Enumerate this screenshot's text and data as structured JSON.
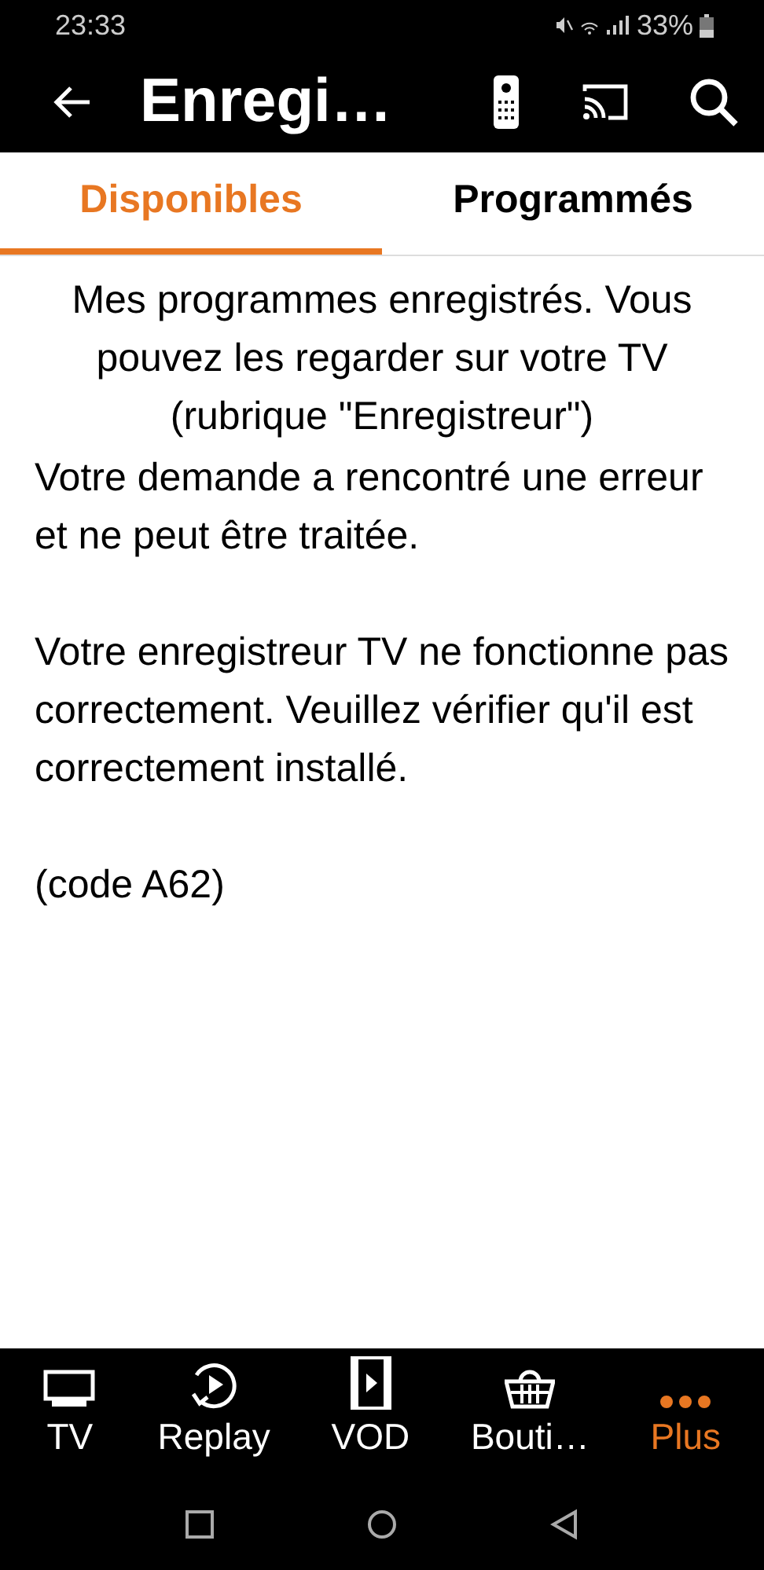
{
  "status_bar": {
    "time": "23:33",
    "battery": "33%"
  },
  "app_bar": {
    "title": "Enregi…"
  },
  "tabs": [
    {
      "label": "Disponibles",
      "selected": true
    },
    {
      "label": "Programmés",
      "selected": false
    }
  ],
  "intro": "Mes programmes enregistrés. Vous pouvez les regarder sur votre TV (rubrique \"Enregistreur\")",
  "messages": [
    "Votre demande a rencontré une erreur et ne peut être traitée.",
    "Votre enregistreur TV ne fonctionne pas correctement. Veuillez vérifier qu'il est correctement installé.",
    "(code A62)"
  ],
  "bottom_nav": [
    {
      "kind": "tv",
      "label": "TV",
      "selected": false
    },
    {
      "kind": "replay",
      "label": "Replay",
      "selected": false
    },
    {
      "kind": "vod",
      "label": "VOD",
      "selected": false
    },
    {
      "kind": "shop",
      "label": "Bouti…",
      "selected": false
    },
    {
      "kind": "more",
      "label": "Plus",
      "selected": true
    }
  ]
}
